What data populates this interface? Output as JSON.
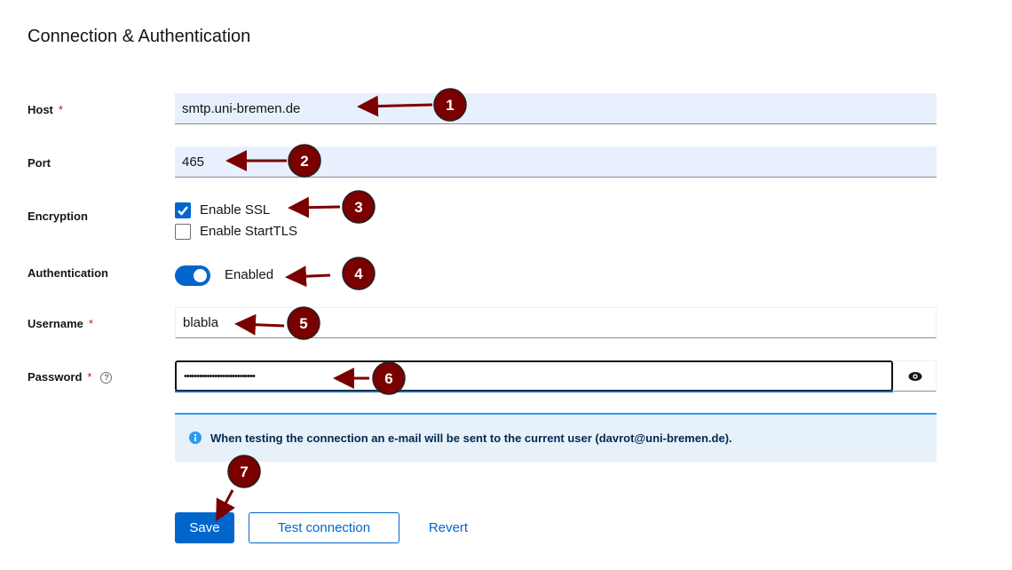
{
  "section_title": "Connection & Authentication",
  "fields": {
    "host": {
      "label": "Host",
      "required": "*",
      "value": "smtp.uni-bremen.de"
    },
    "port": {
      "label": "Port",
      "value": "465"
    },
    "encryption": {
      "label": "Encryption",
      "options": [
        {
          "label": "Enable SSL",
          "checked": true
        },
        {
          "label": "Enable StartTLS",
          "checked": false
        }
      ]
    },
    "authentication": {
      "label": "Authentication",
      "toggle_label": "Enabled",
      "on": true
    },
    "username": {
      "label": "Username",
      "required": "*",
      "value": "blabla"
    },
    "password": {
      "label": "Password",
      "required": "*",
      "help": "?",
      "value": "••••••••••••••••••••••••••••",
      "reveal_icon": "eye-icon"
    }
  },
  "alert": {
    "icon": "info-circle-icon",
    "text": "When testing the connection an e-mail will be sent to the current user (davrot@uni-bremen.de)."
  },
  "actions": {
    "save": "Save",
    "test": "Test connection",
    "revert": "Revert"
  },
  "annotations": [
    "1",
    "2",
    "3",
    "4",
    "5",
    "6",
    "7"
  ],
  "colors": {
    "primary": "#0066cc",
    "annotation": "#7a0000",
    "required": "#c9190b",
    "input_fill": "#e8f0fe",
    "alert_bg": "#e7f1fa"
  }
}
